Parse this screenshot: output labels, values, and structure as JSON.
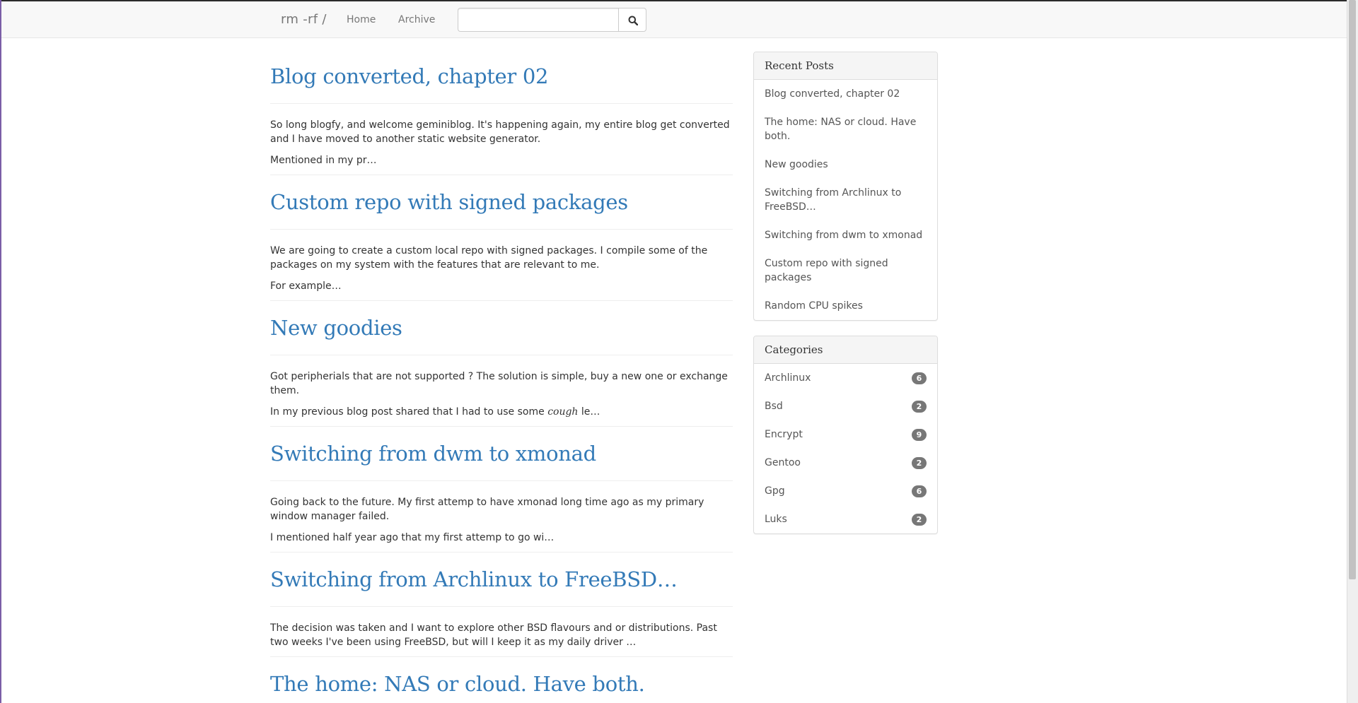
{
  "navbar": {
    "brand": "rm -rf /",
    "links": [
      "Home",
      "Archive"
    ],
    "search_value": ""
  },
  "posts": [
    {
      "title": "Blog converted, chapter 02",
      "paragraphs": [
        "So long blogfy, and welcome geminiblog. It's happening again, my entire blog get converted and I have moved to another static website generator.",
        "Mentioned in my pr…"
      ]
    },
    {
      "title": "Custom repo with signed packages",
      "paragraphs": [
        "We are going to create a custom local repo with signed packages. I compile some of the packages on my system with the features that are relevant to me.",
        "For example…"
      ]
    },
    {
      "title": "New goodies",
      "paragraphs": [
        "Got peripherials that are not supported ? The solution is simple, buy a new one or exchange them."
      ],
      "last_paragraph": {
        "before": "In my previous blog post shared that I had to use some ",
        "em": "cough",
        "after": " le…"
      }
    },
    {
      "title": "Switching from dwm to xmonad",
      "paragraphs": [
        "Going back to the future. My first attemp to have xmonad long time ago as my primary window manager failed.",
        "I mentioned half year ago that my first attemp to go wi…"
      ]
    },
    {
      "title": "Switching from Archlinux to FreeBSD…",
      "paragraphs": [
        "The decision was taken and I want to explore other BSD flavours and or distributions. Past two weeks I've been using FreeBSD, but will I keep it as my daily driver …"
      ]
    },
    {
      "title": "The home: NAS or cloud. Have both.",
      "paragraphs": []
    }
  ],
  "sidebar": {
    "recent": {
      "heading": "Recent Posts",
      "items": [
        "Blog converted, chapter 02",
        "The home: NAS or cloud. Have both.",
        "New goodies",
        "Switching from Archlinux to FreeBSD…",
        "Switching from dwm to xmonad",
        "Custom repo with signed packages",
        "Random CPU spikes"
      ]
    },
    "categories": {
      "heading": "Categories",
      "items": [
        {
          "name": "Archlinux",
          "count": "6"
        },
        {
          "name": "Bsd",
          "count": "2"
        },
        {
          "name": "Encrypt",
          "count": "9"
        },
        {
          "name": "Gentoo",
          "count": "2"
        },
        {
          "name": "Gpg",
          "count": "6"
        },
        {
          "name": "Luks",
          "count": "2"
        }
      ]
    }
  },
  "colors": {
    "link": "#337ab7",
    "navbar_bg": "#f8f8f8",
    "badge_bg": "#777777"
  },
  "icons": {
    "search_button": "search-icon"
  }
}
